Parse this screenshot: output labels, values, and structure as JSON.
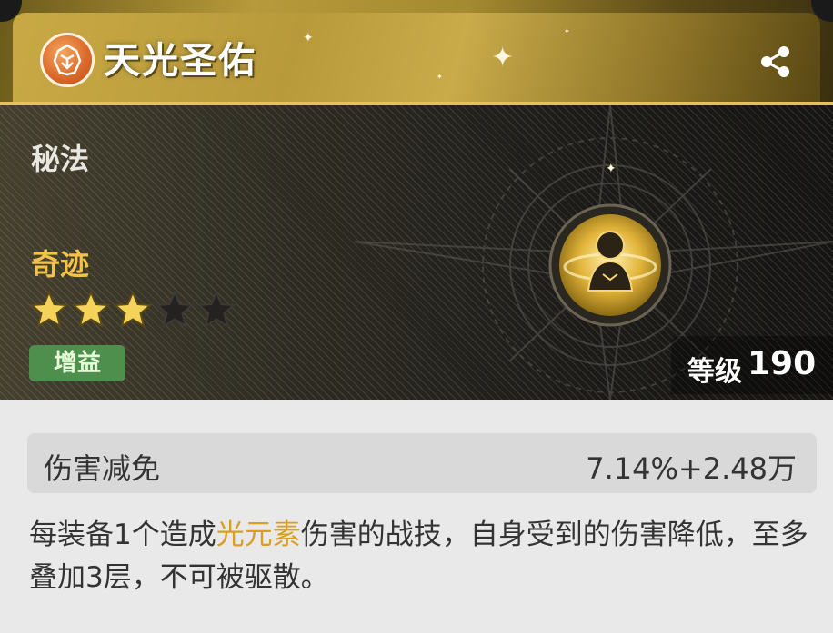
{
  "header": {
    "title": "天光圣佑",
    "emblem_icon": "orange-crest-emblem-icon",
    "share_icon": "share-icon"
  },
  "item": {
    "category": "秘法",
    "rarity": "奇迹",
    "stars_filled": 3,
    "stars_total": 5,
    "tag": "增益",
    "level_label": "等级",
    "level_value": "190",
    "icon": "golden-figure-emblem-icon"
  },
  "stat": {
    "name": "伤害减免",
    "value": "7.14%+2.48万"
  },
  "description": {
    "part1": "每装备1个造成",
    "highlight": "光元素",
    "part2": "伤害的战技，自身受到的伤害降低，至多叠加3层，不可被驱散。"
  },
  "colors": {
    "gold": "#c9ab4a",
    "highlight": "#d9a020",
    "tag_green": "#4e8f4e",
    "rarity": "#f2c24a"
  }
}
